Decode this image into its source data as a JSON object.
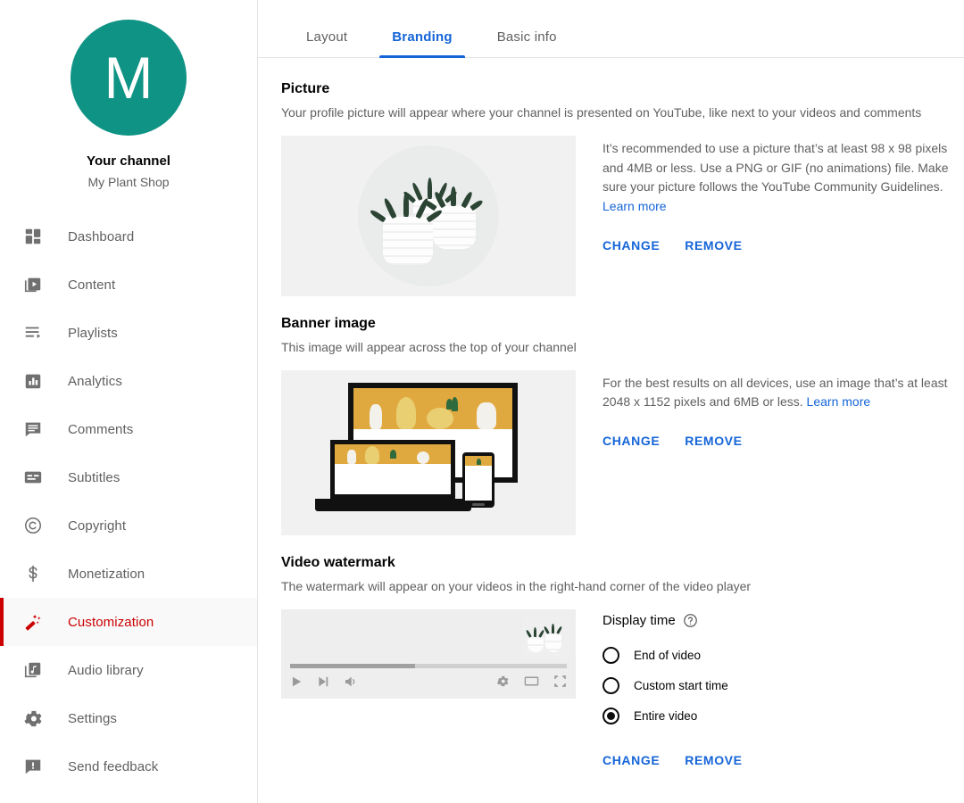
{
  "sidebar": {
    "avatar_letter": "M",
    "avatar_color": "#0e9384",
    "channel_title": "Your channel",
    "channel_name": "My Plant Shop",
    "items": [
      {
        "label": "Dashboard",
        "icon": "dashboard-icon",
        "active": false
      },
      {
        "label": "Content",
        "icon": "content-icon",
        "active": false
      },
      {
        "label": "Playlists",
        "icon": "playlists-icon",
        "active": false
      },
      {
        "label": "Analytics",
        "icon": "analytics-icon",
        "active": false
      },
      {
        "label": "Comments",
        "icon": "comments-icon",
        "active": false
      },
      {
        "label": "Subtitles",
        "icon": "subtitles-icon",
        "active": false
      },
      {
        "label": "Copyright",
        "icon": "copyright-icon",
        "active": false
      },
      {
        "label": "Monetization",
        "icon": "monetization-icon",
        "active": false
      },
      {
        "label": "Customization",
        "icon": "magic-wand-icon",
        "active": true
      },
      {
        "label": "Audio library",
        "icon": "audio-library-icon",
        "active": false
      },
      {
        "label": "Settings",
        "icon": "gear-icon",
        "active": false
      },
      {
        "label": "Send feedback",
        "icon": "feedback-icon",
        "active": false
      }
    ],
    "active_color": "#cc0000"
  },
  "tabs": {
    "active_color": "#1565d8",
    "items": [
      {
        "label": "Layout",
        "active": false
      },
      {
        "label": "Branding",
        "active": true
      },
      {
        "label": "Basic info",
        "active": false
      }
    ]
  },
  "sections": {
    "picture": {
      "title": "Picture",
      "subtitle": "Your profile picture will appear where your channel is presented on YouTube, like next to your videos and comments",
      "help_text": "It’s recommended to use a picture that’s at least 98 x 98 pixels and 4MB or less. Use a PNG or GIF (no animations) file. Make sure your picture follows the YouTube Community Guidelines. ",
      "learn_more": "Learn more",
      "change_label": "CHANGE",
      "remove_label": "REMOVE"
    },
    "banner": {
      "title": "Banner image",
      "subtitle": "This image will appear across the top of your channel",
      "help_text": "For the best results on all devices, use an image that’s at least 2048 x 1152 pixels and 6MB or less. ",
      "learn_more": "Learn more",
      "change_label": "CHANGE",
      "remove_label": "REMOVE"
    },
    "watermark": {
      "title": "Video watermark",
      "subtitle": "The watermark will appear on your videos in the right-hand corner of the video player",
      "display_time_label": "Display time",
      "options": [
        {
          "label": "End of video",
          "selected": false
        },
        {
          "label": "Custom start time",
          "selected": false
        },
        {
          "label": "Entire video",
          "selected": true
        }
      ],
      "change_label": "CHANGE",
      "remove_label": "REMOVE"
    }
  }
}
